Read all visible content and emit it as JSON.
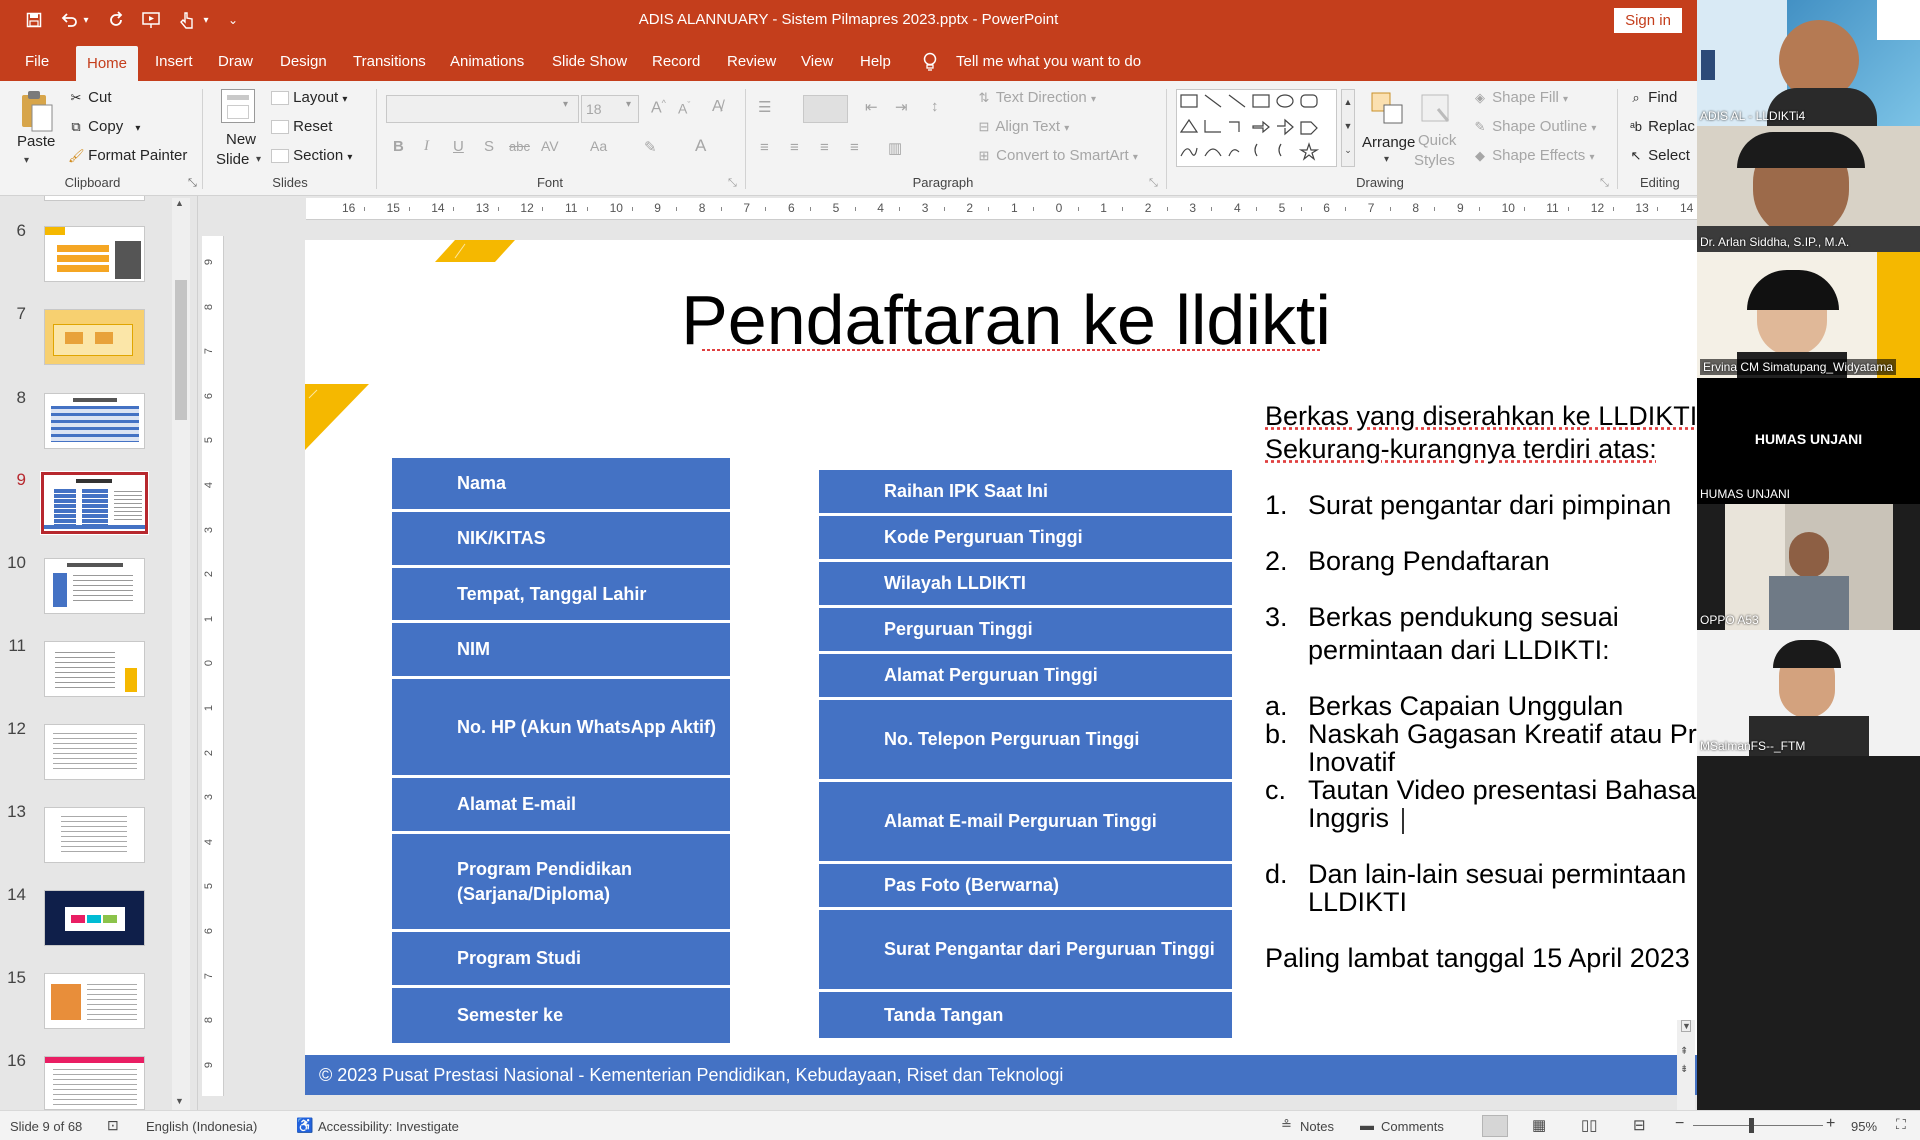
{
  "window": {
    "title": "ADIS ALANNUARY - Sistem Pilmapres 2023.pptx  -  PowerPoint",
    "signin": "Sign in"
  },
  "tabs": [
    "File",
    "Home",
    "Insert",
    "Draw",
    "Design",
    "Transitions",
    "Animations",
    "Slide Show",
    "Record",
    "Review",
    "View",
    "Help"
  ],
  "tell_me": "Tell me what you want to do",
  "ribbon": {
    "clipboard": {
      "paste": "Paste",
      "cut": "Cut",
      "copy": "Copy",
      "format_painter": "Format Painter",
      "label": "Clipboard"
    },
    "slides": {
      "new_slide_1": "New",
      "new_slide_2": "Slide",
      "layout": "Layout",
      "reset": "Reset",
      "section": "Section",
      "label": "Slides"
    },
    "font": {
      "size": "18",
      "label": "Font"
    },
    "paragraph": {
      "text_direction": "Text Direction",
      "align_text": "Align Text",
      "convert_smartart": "Convert to SmartArt",
      "label": "Paragraph"
    },
    "drawing": {
      "arrange": "Arrange",
      "quick_styles_1": "Quick",
      "quick_styles_2": "Styles",
      "shape_fill": "Shape Fill",
      "shape_outline": "Shape Outline",
      "shape_effects": "Shape Effects",
      "label": "Drawing"
    },
    "editing": {
      "find": "Find",
      "replace": "Replac",
      "select": "Select",
      "label": "Editing"
    }
  },
  "thumbnails": [
    {
      "num": "6"
    },
    {
      "num": "7"
    },
    {
      "num": "8"
    },
    {
      "num": "9"
    },
    {
      "num": "10"
    },
    {
      "num": "11"
    },
    {
      "num": "12"
    },
    {
      "num": "13"
    },
    {
      "num": "14"
    },
    {
      "num": "15"
    },
    {
      "num": "16"
    }
  ],
  "ruler_h": [
    "16",
    "15",
    "14",
    "13",
    "12",
    "11",
    "10",
    "9",
    "8",
    "7",
    "6",
    "5",
    "4",
    "3",
    "2",
    "1",
    "0",
    "1",
    "2",
    "3",
    "4",
    "5",
    "6",
    "7",
    "8",
    "9",
    "10",
    "11",
    "12",
    "13",
    "14"
  ],
  "ruler_v": [
    "9",
    "8",
    "7",
    "6",
    "5",
    "4",
    "3",
    "2",
    "1",
    "0",
    "1",
    "2",
    "3",
    "4",
    "5",
    "6",
    "7",
    "8",
    "9"
  ],
  "slide": {
    "title": "Pendaftaran ke lldikti",
    "left_column": [
      "Nama",
      "NIK/KITAS",
      "Tempat, Tanggal Lahir",
      "NIM",
      "No. HP (Akun WhatsApp Aktif)",
      "Alamat E-mail",
      "Program Pendidikan (Sarjana/Diploma)",
      "Program Studi",
      "Semester ke"
    ],
    "right_column": [
      "Raihan IPK Saat Ini",
      "Kode Perguruan Tinggi",
      "Wilayah LLDIKTI",
      "Perguruan Tinggi",
      "Alamat Perguruan Tinggi",
      "No. Telepon Perguruan Tinggi",
      "Alamat E-mail Perguruan Tinggi",
      "Pas Foto (Berwarna)",
      "Surat Pengantar dari Perguruan Tinggi",
      "Tanda Tangan"
    ],
    "intro_1": "Berkas yang diserahkan ke LLDIKTI",
    "intro_2": "Sekurang-kurangnya terdiri atas:",
    "items": [
      {
        "num": "1.",
        "text": "Surat pengantar dari pimpinan"
      },
      {
        "num": "2.",
        "text": "Borang Pendaftaran"
      },
      {
        "num": "3.",
        "text": "Berkas pendukung sesuai"
      },
      {
        "num": "",
        "text": "permintaan dari LLDIKTI:"
      }
    ],
    "subitems": [
      {
        "num": "a.",
        "text": "Berkas Capaian Unggulan"
      },
      {
        "num": "b.",
        "text": "Naskah Gagasan Kreatif atau Produk"
      },
      {
        "num": "",
        "text": "Inovatif"
      },
      {
        "num": "c.",
        "text": "Tautan Video presentasi Bahasa"
      },
      {
        "num": "",
        "text": "Inggris"
      },
      {
        "num": "d.",
        "text": "Dan lain-lain sesuai permintaan"
      },
      {
        "num": "",
        "text": "LLDIKTI"
      }
    ],
    "deadline": "Paling lambat tanggal 15 April 2023",
    "footer": "© 2023 Pusat Prestasi Nasional - Kementerian Pendidikan, Kebudayaan, Riset dan Teknologi"
  },
  "participants": [
    {
      "name": "ADIS AL - LLDIKTi4"
    },
    {
      "name": "Dr. Arlan Siddha, S.IP., M.A."
    },
    {
      "name": "Ervina CM Simatupang_Widyatama"
    },
    {
      "name": "HUMAS UNJANI",
      "center": "HUMAS UNJANI"
    },
    {
      "name": "OPPO A53"
    },
    {
      "name": "MSalmanFS--_FTM"
    }
  ],
  "status": {
    "slide": "Slide 9 of 68",
    "language": "English (Indonesia)",
    "accessibility": "Accessibility: Investigate",
    "notes": "Notes",
    "comments": "Comments",
    "zoom": "95%"
  },
  "colors": {
    "accent": "#c43e1c",
    "table_blue": "#4472c4",
    "selected_thumb": "#b7282e",
    "slide_gold": "#f5b800"
  }
}
